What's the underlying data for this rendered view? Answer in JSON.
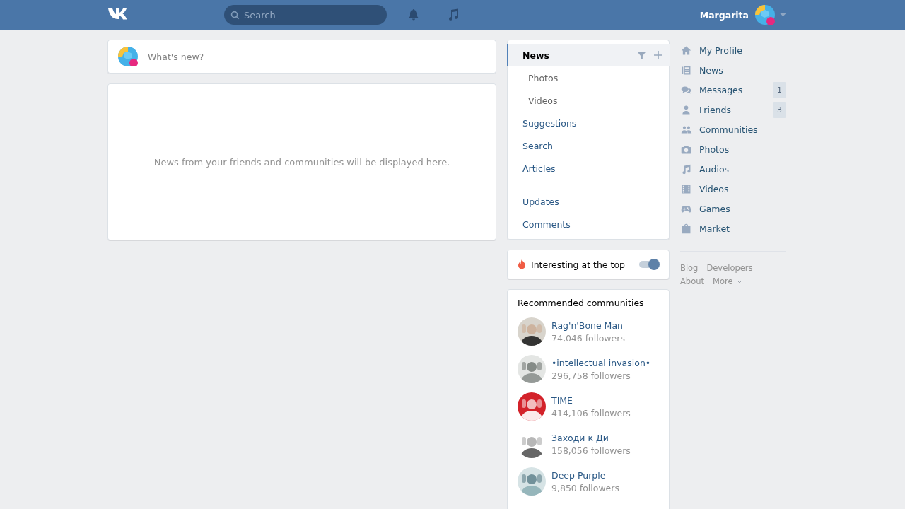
{
  "header": {
    "search": {
      "placeholder": "Search"
    },
    "user_name": "Margarita"
  },
  "composer": {
    "placeholder": "What's new?"
  },
  "feed": {
    "empty_message": "News from your friends and communities will be displayed here."
  },
  "filter_menu": {
    "sections": [
      {
        "items": [
          {
            "label": "News",
            "kind": "main",
            "selected": true
          },
          {
            "label": "Photos",
            "kind": "sub",
            "selected": false
          },
          {
            "label": "Videos",
            "kind": "sub",
            "selected": false
          },
          {
            "label": "Suggestions",
            "kind": "main",
            "selected": false
          },
          {
            "label": "Search",
            "kind": "main",
            "selected": false
          },
          {
            "label": "Articles",
            "kind": "main",
            "selected": false
          }
        ]
      },
      {
        "items": [
          {
            "label": "Updates",
            "kind": "main",
            "selected": false
          },
          {
            "label": "Comments",
            "kind": "main",
            "selected": false
          }
        ]
      }
    ]
  },
  "interesting_toggle": {
    "label": "Interesting at the top",
    "on": true
  },
  "recommended": {
    "title": "Recommended communities",
    "items": [
      {
        "name": "Rag'n'Bone Man",
        "followers": "74,046 followers"
      },
      {
        "name": "•intellectual invasion•",
        "followers": "296,758 followers"
      },
      {
        "name": "TIME",
        "followers": "414,106 followers"
      },
      {
        "name": "Заходи к Ди",
        "followers": "158,056 followers"
      },
      {
        "name": "Deep Purple",
        "followers": "9,850 followers"
      }
    ]
  },
  "side_nav": {
    "items": [
      {
        "label": "My Profile"
      },
      {
        "label": "News"
      },
      {
        "label": "Messages",
        "count": "1"
      },
      {
        "label": "Friends",
        "count": "3"
      },
      {
        "label": "Communities"
      },
      {
        "label": "Photos"
      },
      {
        "label": "Audios"
      },
      {
        "label": "Videos"
      },
      {
        "label": "Games"
      },
      {
        "label": "Market"
      }
    ]
  },
  "footer_links": [
    "Blog",
    "Developers",
    "About",
    "More"
  ]
}
